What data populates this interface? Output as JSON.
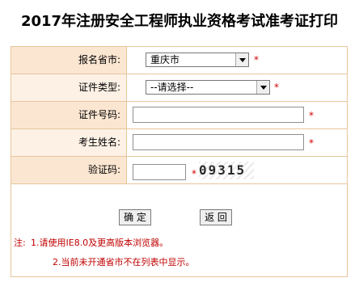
{
  "title": "2017年注册安全工程师执业资格考试准考证打印",
  "form": {
    "province": {
      "label": "报名省市:",
      "value": "重庆市"
    },
    "id_type": {
      "label": "证件类型:",
      "value": "--请选择--"
    },
    "id_number": {
      "label": "证件号码:",
      "value": ""
    },
    "name": {
      "label": "考生姓名:",
      "value": ""
    },
    "captcha": {
      "label": "验证码:",
      "value": "",
      "image_text": "09315"
    },
    "required_mark": "*"
  },
  "buttons": {
    "confirm": "确 定",
    "back": "返 回"
  },
  "notes": {
    "prefix": "注:",
    "line1": "1.请使用IE8.0及更高版本浏览器。",
    "line2": "2.当前未开通省市不在列表中显示。"
  },
  "colors": {
    "border": "#e7c69b",
    "label_bg": "#fbe6d2",
    "required": "#d40000",
    "note_text": "#c00000"
  }
}
